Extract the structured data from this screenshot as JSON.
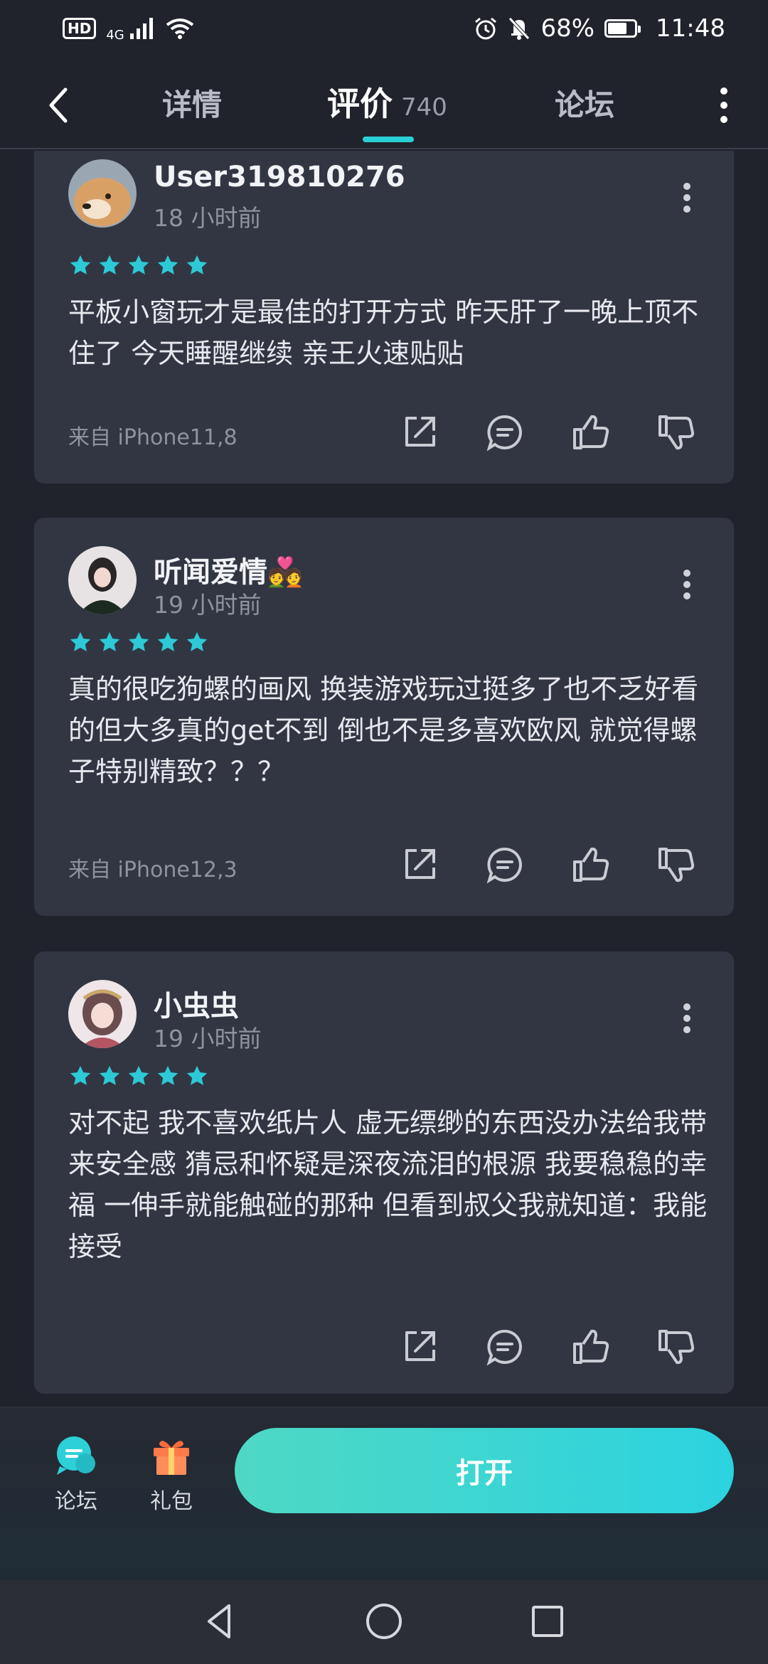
{
  "status_bar": {
    "hd": "HD",
    "network": "4G",
    "battery": "68%",
    "time": "11:48"
  },
  "nav": {
    "tabs": [
      {
        "label": "详情"
      },
      {
        "label": "评价",
        "count": "740"
      },
      {
        "label": "论坛"
      }
    ]
  },
  "reviews": [
    {
      "username": "User319810276",
      "time": "18 小时前",
      "rating": 5,
      "text": "平板小窗玩才是最佳的打开方式 昨天肝了一晚上顶不住了 今天睡醒继续 亲王火速贴贴",
      "device": "来自 iPhone11,8"
    },
    {
      "username": "听闻爱情💑",
      "time": "19 小时前",
      "rating": 5,
      "text": "真的很吃狗螺的画风 换装游戏玩过挺多了也不乏好看的但大多真的get不到 倒也不是多喜欢欧风 就觉得螺子特别精致？？？",
      "device": "来自 iPhone12,3"
    },
    {
      "username": "小虫虫",
      "time": "19 小时前",
      "rating": 5,
      "text": "对不起 我不喜欢纸片人 虚无缥缈的东西没办法给我带来安全感 猜忌和怀疑是深夜流泪的根源 我要稳稳的幸福 一伸手就能触碰的那种 但看到叔父我就知道：我能接受",
      "device": ""
    }
  ],
  "bottom_bar": {
    "forum_label": "论坛",
    "gift_label": "礼包",
    "open_label": "打开"
  },
  "colors": {
    "accent": "#2bd0d6",
    "star": "#2ec9d6",
    "card": "#323643",
    "background": "#20232c"
  }
}
